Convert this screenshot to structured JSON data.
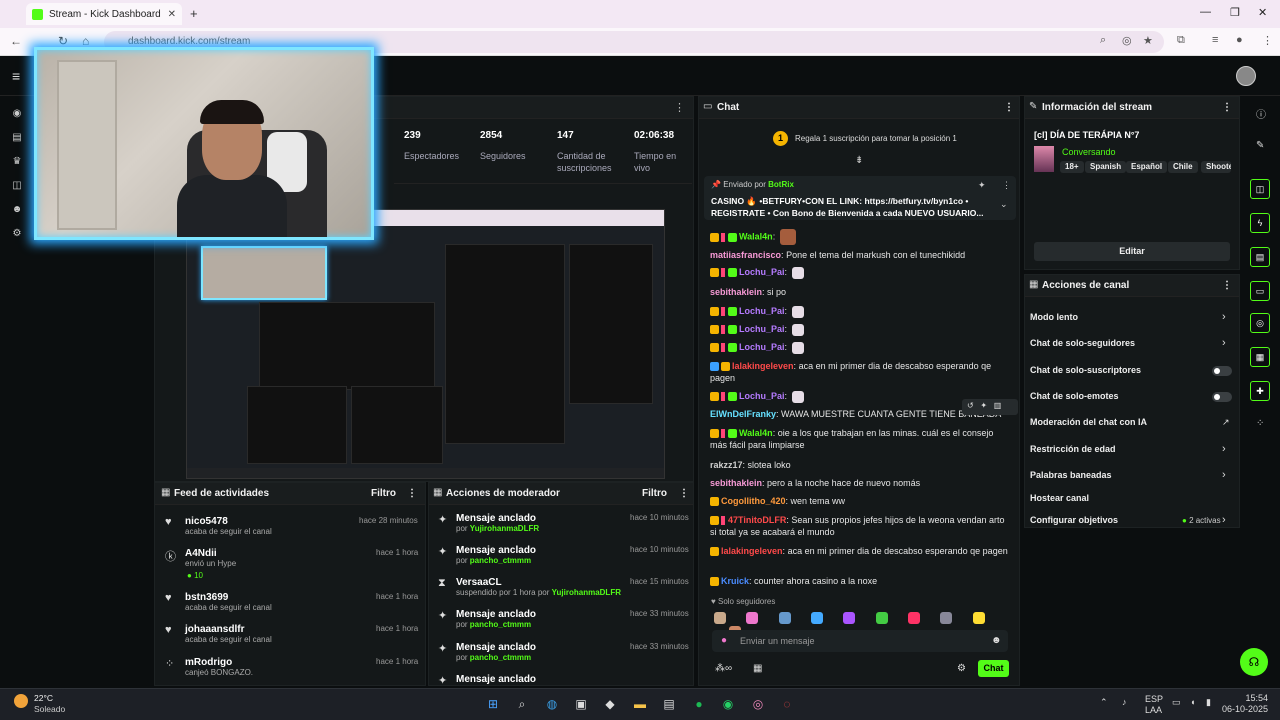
{
  "browser": {
    "tab_title": "Stream - Kick Dashboard",
    "new_tab": "+",
    "url": "dashboard.kick.com/stream",
    "win_min": "—",
    "win_max": "❐",
    "win_close": "✕"
  },
  "stats": [
    {
      "value": "239",
      "label": "Espectadores"
    },
    {
      "value": "2854",
      "label": "Seguidores"
    },
    {
      "value": "147",
      "label": "Cantidad de suscripciones"
    },
    {
      "value": "02:06:38",
      "label": "Tiempo en vivo"
    }
  ],
  "feed": {
    "title": "Feed de actividades",
    "filter": "Filtro",
    "items": [
      {
        "name": "nico5478",
        "sub": "acaba de seguir el canal",
        "time": "hace 28 minutos"
      },
      {
        "name": "A4Ndii",
        "sub": "envió un Hype",
        "extra": "10",
        "time": "hace 1 hora"
      },
      {
        "name": "bstn3699",
        "sub": "acaba de seguir el canal",
        "time": "hace 1 hora"
      },
      {
        "name": "johaaansdlfr",
        "sub": "acaba de seguir el canal",
        "time": "hace 1 hora"
      },
      {
        "name": "mRodrigo",
        "sub": "canjeó BONGAZO.",
        "time": "hace 1 hora"
      }
    ]
  },
  "mod": {
    "title": "Acciones de moderador",
    "filter": "Filtro",
    "items": [
      {
        "title": "Mensaje anclado",
        "by": "por",
        "user": "YujirohanmaDLFR",
        "time": "hace 10 minutos"
      },
      {
        "title": "Mensaje anclado",
        "by": "por",
        "user": "pancho_ctmmm",
        "time": "hace 10 minutos"
      },
      {
        "title": "VersaaCL",
        "by": "suspendido por 1 hora por",
        "user": "YujirohanmaDLFR",
        "time": "hace 15 minutos"
      },
      {
        "title": "Mensaje anclado",
        "by": "por",
        "user": "pancho_ctmmm",
        "time": "hace 33 minutos"
      },
      {
        "title": "Mensaje anclado",
        "by": "por",
        "user": "pancho_ctmmm",
        "time": "hace 33 minutos"
      },
      {
        "title": "Mensaje anclado",
        "by": "",
        "user": "",
        "time": ""
      }
    ]
  },
  "chat": {
    "title": "Chat",
    "gift_banner": "Regala 1 suscripción para tomar la posición 1",
    "gift_rank": "1",
    "pinned_by": "Enviado por",
    "pinned_user": "BotRix",
    "pinned_text": "CASINO 🔥 •BETFURY•CON EL LINK: https://betfury.tv/byn1co • REGISTRATE • Con Bono de Bienvenida a cada NUEVO USUARIO...",
    "messages": [
      {
        "user": "Walal4n",
        "color": "#53fc18",
        "text": "",
        "badges": "yrg"
      },
      {
        "user": "matiiasfrancisco",
        "color": "#f79ad6",
        "text": "Pone el tema del markush con el tunechikidd",
        "badges": ""
      },
      {
        "user": "Lochu_Pai",
        "color": "#b57bff",
        "text": "",
        "badges": "yrg"
      },
      {
        "user": "sebithaklein",
        "color": "#f79ad6",
        "text": "si po",
        "badges": ""
      },
      {
        "user": "Lochu_Pai",
        "color": "#b57bff",
        "text": "",
        "badges": "yrg"
      },
      {
        "user": "Lochu_Pai",
        "color": "#b57bff",
        "text": "",
        "badges": "yrg"
      },
      {
        "user": "Lochu_Pai",
        "color": "#b57bff",
        "text": "",
        "badges": "yrg"
      },
      {
        "user": "lalakingeleven",
        "color": "#ff4a4a",
        "text": "aca en mi primer dia de descabso esperando qe pagen",
        "badges": "by"
      },
      {
        "user": "Lochu_Pai",
        "color": "#b57bff",
        "text": "",
        "badges": "yrg"
      },
      {
        "user": "ElWnDelFranky",
        "color": "#66e0ff",
        "text": "WAWA MUESTRE CUANTA GENTE TIENE BANEADA",
        "badges": ""
      },
      {
        "user": "Walal4n",
        "color": "#53fc18",
        "text": "oie a los que trabajan en las minas. cuál es el consejo más fácil para limpiarse",
        "badges": "yrg"
      },
      {
        "user": "rakzz17",
        "color": "#cfcfcf",
        "text": "slotea loko",
        "badges": ""
      },
      {
        "user": "sebithaklein",
        "color": "#f79ad6",
        "text": "pero a la noche hace de nuevo nomás",
        "badges": ""
      },
      {
        "user": "Cogollitho_420",
        "color": "#ff9a3d",
        "text": "wen tema ww",
        "badges": "y"
      },
      {
        "user": "47TinitoDLFR",
        "color": "#ff4a4a",
        "text": "Sean sus propios jefes hijos de la weona vendan arto si total ya se acabará el mundo",
        "badges": "yr"
      },
      {
        "user": "lalakingeleven",
        "color": "#ff4a4a",
        "text": "aca en mi primer dia de descabso esperando qe pagen",
        "badges": "y"
      },
      {
        "user": "Kruick",
        "color": "#4a8cff",
        "text": "counter ahora casino a la noxe",
        "badges": "y"
      }
    ],
    "mode_label": "Solo seguidores",
    "input_placeholder": "Enviar un mensaje",
    "send_label": "Chat"
  },
  "info": {
    "title": "Información del stream",
    "stream_title": "[cl] DÍA DE TERÁPIA N°7",
    "category": "Conversando",
    "tags": [
      "18+",
      "Spanish",
      "Español",
      "Chile",
      "Shoote"
    ],
    "edit_label": "Editar"
  },
  "actions": {
    "title": "Acciones de canal",
    "rows": [
      {
        "label": "Modo lento",
        "control": "chevron"
      },
      {
        "label": "Chat de solo-seguidores",
        "control": "chevron"
      },
      {
        "label": "Chat de solo-suscriptores",
        "control": "toggle"
      },
      {
        "label": "Chat de solo-emotes",
        "control": "toggle"
      },
      {
        "label": "Moderación del chat con IA",
        "control": "external"
      },
      {
        "label": "Restricción de edad",
        "control": "chevron"
      },
      {
        "label": "Palabras baneadas",
        "control": "chevron"
      },
      {
        "label": "Hostear canal",
        "control": "none"
      },
      {
        "label": "Configurar objetivos",
        "control": "chevron",
        "status": "2 activas"
      }
    ]
  },
  "taskbar": {
    "weather_temp": "22°C",
    "weather_desc": "Soleado",
    "lang": "ESP",
    "lang2": "LAA",
    "time": "15:54",
    "date": "06-10-2025"
  }
}
